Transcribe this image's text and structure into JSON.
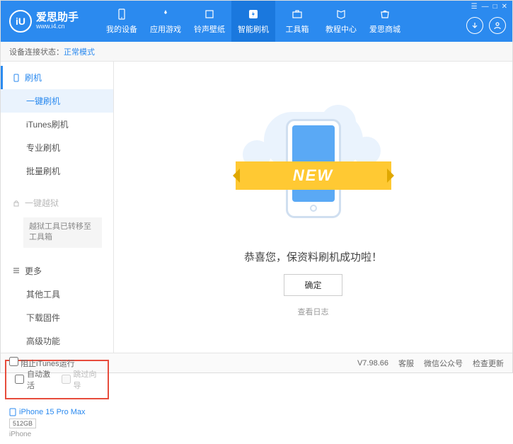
{
  "header": {
    "logo_badge": "iU",
    "logo_title": "爱思助手",
    "logo_url": "www.i4.cn",
    "nav": [
      {
        "label": "我的设备"
      },
      {
        "label": "应用游戏"
      },
      {
        "label": "铃声壁纸"
      },
      {
        "label": "智能刷机"
      },
      {
        "label": "工具箱"
      },
      {
        "label": "教程中心"
      },
      {
        "label": "爱思商城"
      }
    ],
    "win_controls": [
      "☰",
      "—",
      "□",
      "✕"
    ]
  },
  "status": {
    "label": "设备连接状态：",
    "value": "正常模式"
  },
  "sidebar": {
    "section_flash": "刷机",
    "items_flash": [
      "一键刷机",
      "iTunes刷机",
      "专业刷机",
      "批量刷机"
    ],
    "section_jailbreak": "一键越狱",
    "jailbreak_note": "越狱工具已转移至工具箱",
    "section_more": "更多",
    "items_more": [
      "其他工具",
      "下载固件",
      "高级功能"
    ],
    "checkbox_auto": "自动激活",
    "checkbox_skip": "跳过向导"
  },
  "device": {
    "name": "iPhone 15 Pro Max",
    "storage": "512GB",
    "type": "iPhone"
  },
  "main": {
    "ribbon": "NEW",
    "success": "恭喜您，保资料刷机成功啦！",
    "ok": "确定",
    "log": "查看日志"
  },
  "footer": {
    "block_itunes": "阻止iTunes运行",
    "version": "V7.98.66",
    "right": [
      "客服",
      "微信公众号",
      "检查更新"
    ]
  }
}
